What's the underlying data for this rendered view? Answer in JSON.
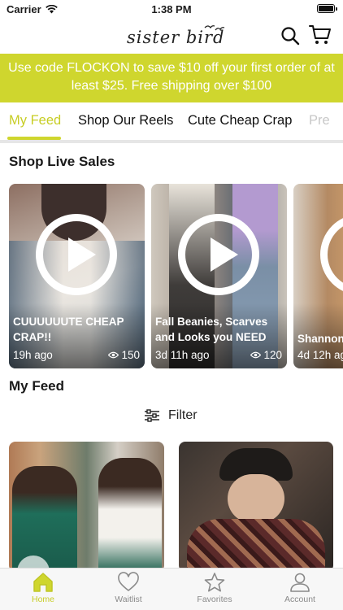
{
  "status_bar": {
    "carrier": "Carrier",
    "time": "1:38 PM"
  },
  "header": {
    "logo_text": "sister bird"
  },
  "promo": {
    "text": "Use code FLOCKON to save $10 off your first order of at least $25. Free shipping over $100"
  },
  "tabs": [
    {
      "label": "My Feed",
      "active": true
    },
    {
      "label": "Shop Our Reels"
    },
    {
      "label": "Cute Cheap Crap"
    },
    {
      "label": "Pre"
    }
  ],
  "live_sales": {
    "title": "Shop Live Sales",
    "items": [
      {
        "caption": "CUUUUUUTE CHEAP CRAP!!",
        "age": "19h ago",
        "views": "150"
      },
      {
        "caption": "Fall Beanies, Scarves and Looks you NEED",
        "age": "3d 11h ago",
        "views": "120"
      },
      {
        "caption": "Shannon",
        "age": "4d 12h ag",
        "views": ""
      }
    ]
  },
  "feed": {
    "title": "My Feed",
    "filter_label": "Filter"
  },
  "bottom_nav": [
    {
      "label": "Home",
      "icon": "home-icon",
      "active": true
    },
    {
      "label": "Waitlist",
      "icon": "heart-icon"
    },
    {
      "label": "Favorites",
      "icon": "star-icon"
    },
    {
      "label": "Account",
      "icon": "person-icon"
    }
  ],
  "colors": {
    "accent": "#cfd62e",
    "promo_text": "#ffffff",
    "inactive_nav": "#8a8a8a"
  }
}
